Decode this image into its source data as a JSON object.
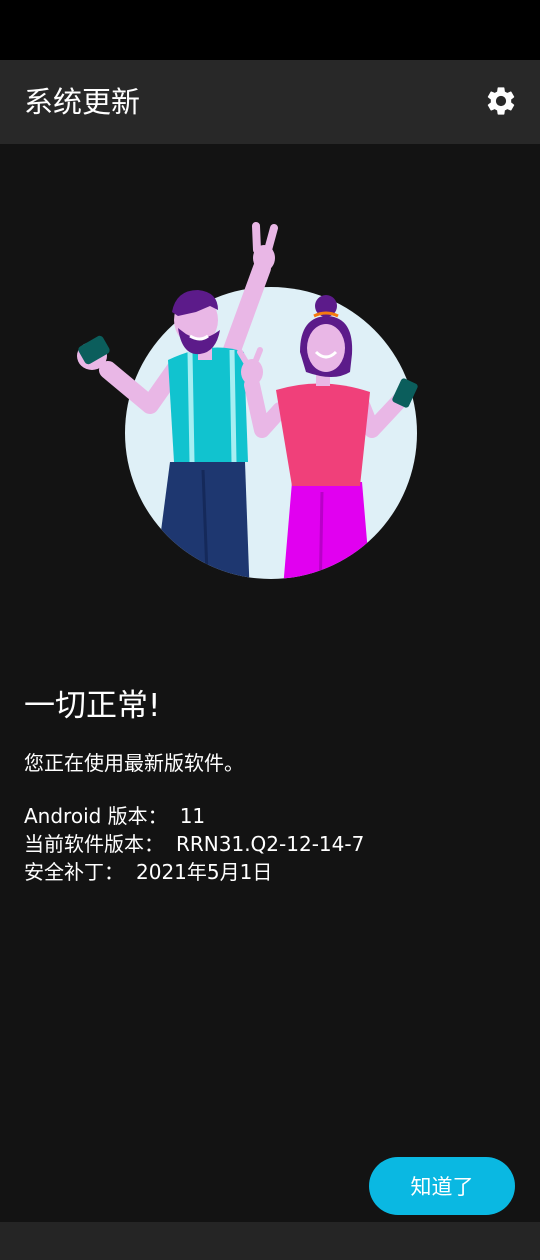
{
  "header": {
    "title": "系统更新",
    "settings_icon": "gear-icon"
  },
  "hero": {
    "illustration": "celebrating-couple"
  },
  "main": {
    "headline": "一切正常!",
    "subtitle": "您正在使用最新版软件。",
    "info": [
      {
        "label": "Android 版本：",
        "value": "11"
      },
      {
        "label": "当前软件版本：",
        "value": "RRN31.Q2-12-14-7"
      },
      {
        "label": "安全补丁：",
        "value": "2021年5月1日"
      }
    ]
  },
  "actions": {
    "ok_label": "知道了"
  },
  "colors": {
    "accent": "#0ab8e2",
    "background": "#131313",
    "app_bar": "#282828"
  }
}
